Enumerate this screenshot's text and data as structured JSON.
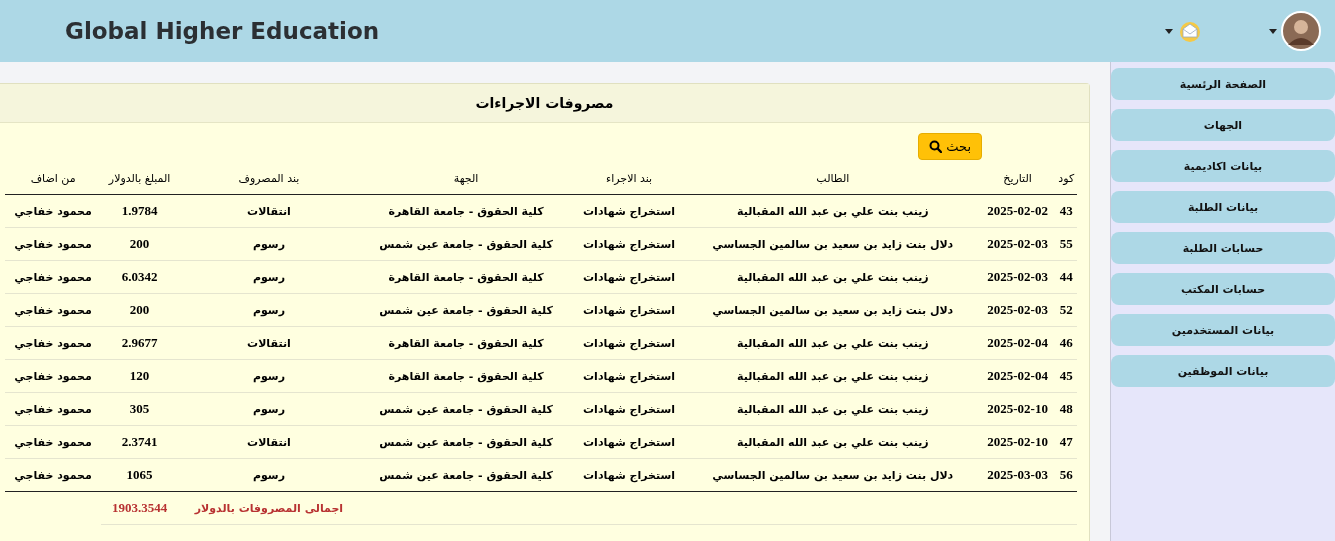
{
  "header": {
    "title": "Global Higher Education"
  },
  "card": {
    "title": "مصروفات الاجراءات",
    "search_button": "بحث"
  },
  "table": {
    "columns": [
      "كود",
      "التاريخ",
      "الطالب",
      "بند الاجراء",
      "الجهة",
      "بند المصروف",
      "المبلغ بالدولار",
      "من اضاف"
    ],
    "rows": [
      [
        "43",
        "2025-02-02",
        "زينب بنت علي بن عبد الله المقبالية",
        "استخراج شهادات",
        "كلية الحقوق - جامعة القاهرة",
        "انتقالات",
        "1.9784",
        "محمود خفاجي"
      ],
      [
        "55",
        "2025-02-03",
        "دلال بنت زايد بن سعيد بن سالمين الجساسي",
        "استخراج شهادات",
        "كلية الحقوق - جامعة عين شمس",
        "رسوم",
        "200",
        "محمود خفاجي"
      ],
      [
        "44",
        "2025-02-03",
        "زينب بنت علي بن عبد الله المقبالية",
        "استخراج شهادات",
        "كلية الحقوق - جامعة القاهرة",
        "رسوم",
        "6.0342",
        "محمود خفاجي"
      ],
      [
        "52",
        "2025-02-03",
        "دلال بنت زايد بن سعيد بن سالمين الجساسي",
        "استخراج شهادات",
        "كلية الحقوق - جامعة عين شمس",
        "رسوم",
        "200",
        "محمود خفاجي"
      ],
      [
        "46",
        "2025-02-04",
        "زينب بنت علي بن عبد الله المقبالية",
        "استخراج شهادات",
        "كلية الحقوق - جامعة القاهرة",
        "انتقالات",
        "2.9677",
        "محمود خفاجي"
      ],
      [
        "45",
        "2025-02-04",
        "زينب بنت علي بن عبد الله المقبالية",
        "استخراج شهادات",
        "كلية الحقوق - جامعة القاهرة",
        "رسوم",
        "120",
        "محمود خفاجي"
      ],
      [
        "48",
        "2025-02-10",
        "زينب بنت علي بن عبد الله المقبالية",
        "استخراج شهادات",
        "كلية الحقوق - جامعة عين شمس",
        "رسوم",
        "305",
        "محمود خفاجي"
      ],
      [
        "47",
        "2025-02-10",
        "زينب بنت علي بن عبد الله المقبالية",
        "استخراج شهادات",
        "كلية الحقوق - جامعة عين شمس",
        "انتقالات",
        "2.3741",
        "محمود خفاجي"
      ],
      [
        "56",
        "2025-03-03",
        "دلال بنت زايد بن سعيد بن سالمين الجساسي",
        "استخراج شهادات",
        "كلية الحقوق - جامعة عين شمس",
        "رسوم",
        "1065",
        "محمود خفاجي"
      ]
    ],
    "total_label": "اجمالى المصروفات بالدولار",
    "total_value": "1903.3544"
  },
  "sidebar": {
    "items": [
      "الصفحة الرئسية",
      "الجهات",
      "بيانات اكاديمية",
      "بيانات الطلبة",
      "حسابات الطلبة",
      "حسابات المكتب",
      "بيانات المستخدمين",
      "بيانات الموظفين"
    ]
  }
}
